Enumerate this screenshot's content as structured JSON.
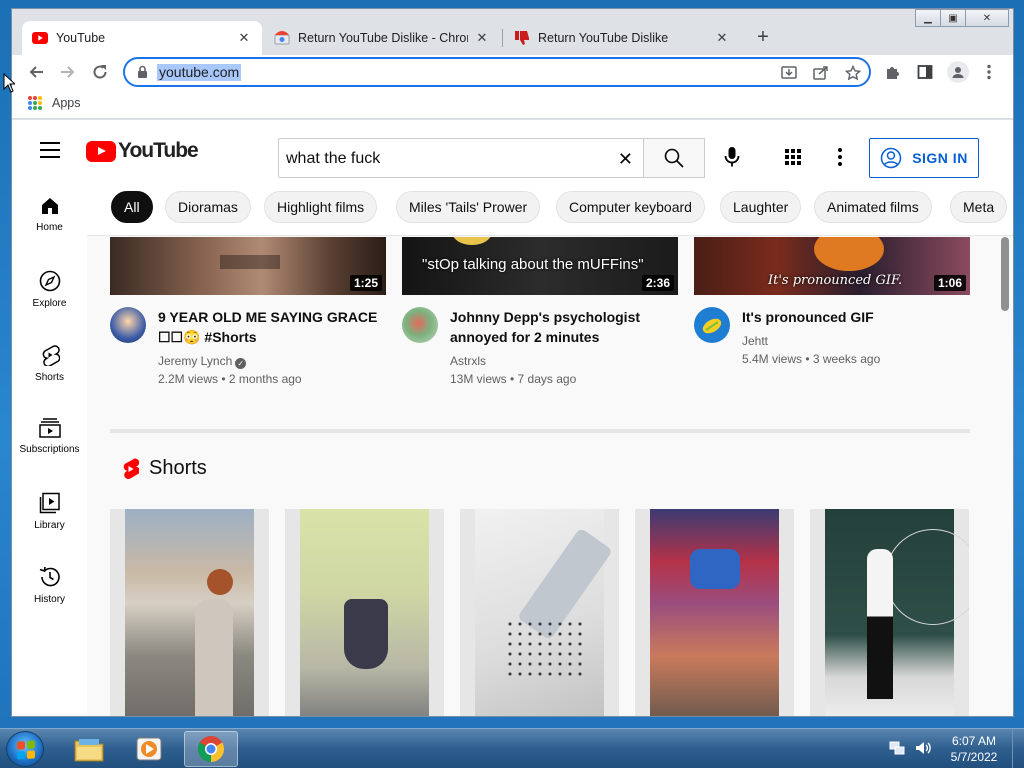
{
  "tabs": [
    {
      "title": "YouTube",
      "active": true
    },
    {
      "title": "Return YouTube Dislike - Chrome",
      "active": false
    },
    {
      "title": "Return YouTube Dislike",
      "active": false
    }
  ],
  "omnibox": {
    "url": "youtube.com"
  },
  "bookmarks": {
    "apps_label": "Apps"
  },
  "youtube": {
    "logo_text": "YouTube",
    "search_query": "what the fuck",
    "sign_in_label": "SIGN IN",
    "chips": [
      "All",
      "Dioramas",
      "Highlight films",
      "Miles 'Tails' Prower",
      "Computer keyboard",
      "Laughter",
      "Animated films",
      "Meta"
    ],
    "sidebar": [
      {
        "label": "Home",
        "icon": "home-icon"
      },
      {
        "label": "Explore",
        "icon": "compass-icon"
      },
      {
        "label": "Shorts",
        "icon": "shorts-icon"
      },
      {
        "label": "Subscriptions",
        "icon": "subscriptions-icon"
      },
      {
        "label": "Library",
        "icon": "library-icon"
      },
      {
        "label": "History",
        "icon": "history-icon"
      }
    ],
    "videos": [
      {
        "title": "9 YEAR OLD ME SAYING GRACE ☐☐😳 #Shorts",
        "channel": "Jeremy Lynch",
        "meta": "2.2M views • 2 months ago",
        "duration": "1:25",
        "verified": true,
        "overlay": ""
      },
      {
        "title": "Johnny Depp's psychologist annoyed for 2 minutes",
        "channel": "Astrxls",
        "meta": "13M views • 7 days ago",
        "duration": "2:36",
        "verified": false,
        "overlay": "\"stOp talking about the mUFFins\""
      },
      {
        "title": "It's pronounced GIF",
        "channel": "Jehtt",
        "meta": "5.4M views • 3 weeks ago",
        "duration": "1:06",
        "verified": false,
        "overlay": "It's pronounced GIF."
      }
    ],
    "shorts_title": "Shorts"
  },
  "taskbar": {
    "time": "6:07 AM",
    "date": "5/7/2022"
  },
  "colors": {
    "youtube_red": "#ff0000",
    "chrome_blue": "#1a73e8",
    "signin_blue": "#065fd4"
  }
}
